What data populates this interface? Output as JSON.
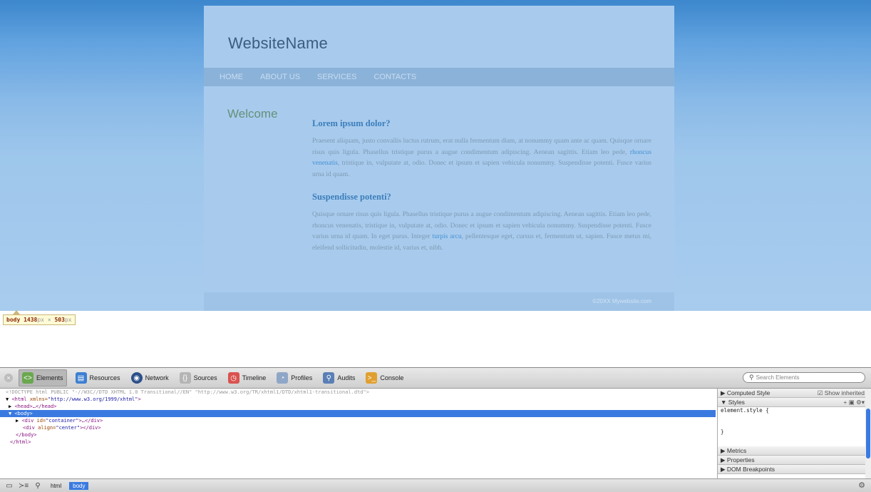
{
  "page": {
    "site_name": "WebsiteName",
    "nav": [
      "HOME",
      "ABOUT US",
      "SERVICES",
      "CONTACTS"
    ],
    "welcome": "Welcome",
    "heading1": "Lorem ipsum dolor?",
    "para1_a": "Praesent aliquam, justo convallis luctus rutrum, erat nulla fermentum diam, at nonummy quam ante ac quam. Quisque ornare risus quis ligula. Phasellus tristique purus a augue condimentum adipiscing. Aenean sagittis. Etiam leo pede, ",
    "para1_link": "rhoncus venenatis",
    "para1_b": ", tristique in, vulputate at, odio. Donec et ipsum et sapien vehicula nonummy. Suspendisse potenti. Fusce varius urna id quam.",
    "heading2": "Suspendisse potenti?",
    "para2_a": "Quisque ornare risus quis ligula. Phasellus tristique purus a augue condimentum adipiscing. Aenean sagittis. Etiam leo pede, rhoncus venenatis, tristique in, vulputate at, odio. Donec et ipsum et sapien vehicula nonummy. Suspendisse potenti. Fusce varius urna id quam. In eget purus. Integer ",
    "para2_link": "turpis arcu",
    "para2_b": ", pellentesque eget, cursus et, fermentum ut, sapien. Fusce metus mi, eleifend sollicitudin, molestie id, varius et, nibh.",
    "footer": "©20XX Mywebsite.com"
  },
  "dim_label": {
    "tag": "body",
    "w": "1438",
    "h": "503",
    "unit": "px",
    "x": "×"
  },
  "toolbar": {
    "tools": [
      {
        "label": "Elements",
        "icon": "elements-icon",
        "color": "#6aa84f"
      },
      {
        "label": "Resources",
        "icon": "resources-icon",
        "color": "#3d7fd1"
      },
      {
        "label": "Network",
        "icon": "network-icon",
        "color": "#2b4f8a"
      },
      {
        "label": "Sources",
        "icon": "sources-icon",
        "color": "#8a8a8a"
      },
      {
        "label": "Timeline",
        "icon": "timeline-icon",
        "color": "#d9534f"
      },
      {
        "label": "Profiles",
        "icon": "profiles-icon",
        "color": "#8fa7c7"
      },
      {
        "label": "Audits",
        "icon": "audits-icon",
        "color": "#5a7fb5"
      },
      {
        "label": "Console",
        "icon": "console-icon",
        "color": "#e0a030"
      }
    ],
    "search_placeholder": "Search Elements"
  },
  "dom": {
    "doctype": "<!DOCTYPE html PUBLIC \"-//W3C//DTD XHTML 1.0 Transitional//EN\" \"http://www.w3.org/TR/xhtml1/DTD/xhtml1-transitional.dtd\">",
    "html_open": "<html",
    "html_attr": " xmlns=",
    "html_val": "\"http://www.w3.org/1999/xhtml\"",
    "html_close": ">",
    "head": "<head>…</head>",
    "body": "<body>",
    "div1_open": "<div",
    "div1_attr": " id=",
    "div1_val": "\"container\"",
    "div1_close": ">…</div>",
    "div2_open": "<div",
    "div2_attr": " align=",
    "div2_val": "\"center\"",
    "div2_close": "></div>",
    "body_close": "</body>",
    "html_end": "</html>"
  },
  "sidebar": {
    "computed": "Computed Style",
    "show_inherited": "Show inherited",
    "styles": "Styles",
    "element_style": "element.style {",
    "close_brace": "}",
    "metrics": "Metrics",
    "properties": "Properties",
    "dom_breakpoints": "DOM Breakpoints"
  },
  "statusbar": {
    "crumbs": [
      "html",
      "body"
    ]
  }
}
